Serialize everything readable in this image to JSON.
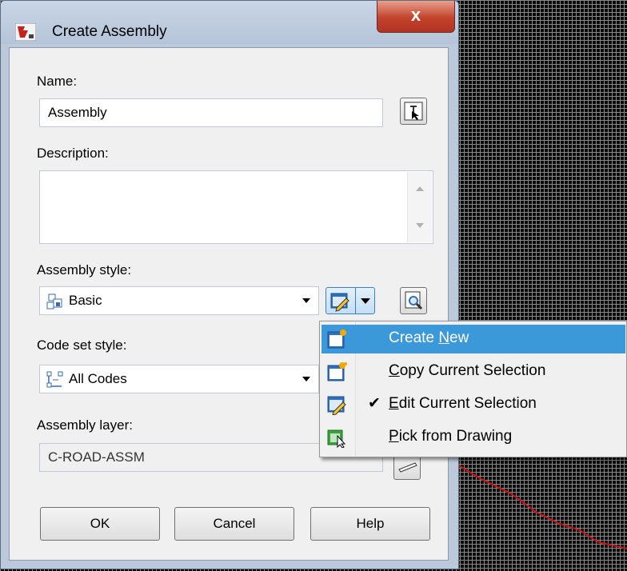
{
  "window": {
    "title": "Create Assembly",
    "close_label": "x"
  },
  "form": {
    "name_label": "Name:",
    "name_value": "Assembly",
    "description_label": "Description:",
    "description_value": "",
    "assembly_style_label": "Assembly style:",
    "assembly_style_value": "Basic",
    "code_set_style_label": "Code set style:",
    "code_set_style_value": "All Codes",
    "assembly_layer_label": "Assembly layer:",
    "assembly_layer_value": "C-ROAD-ASSM"
  },
  "buttons": {
    "ok": "OK",
    "cancel": "Cancel",
    "help": "Help"
  },
  "style_menu": {
    "items": [
      {
        "pre": "Create ",
        "accel": "N",
        "post": "ew",
        "checked": false,
        "highlighted": true,
        "icon": "create-new-icon"
      },
      {
        "pre": "",
        "accel": "C",
        "post": "opy Current Selection",
        "checked": false,
        "highlighted": false,
        "icon": "copy-selection-icon"
      },
      {
        "pre": "",
        "accel": "E",
        "post": "dit Current Selection",
        "checked": true,
        "highlighted": false,
        "icon": "edit-selection-icon"
      },
      {
        "pre": "",
        "accel": "P",
        "post": "ick from Drawing",
        "checked": false,
        "highlighted": false,
        "icon": "pick-from-drawing-icon"
      }
    ],
    "check_glyph": "✔"
  },
  "colors": {
    "menu_highlight": "#3b98d9",
    "close_button": "#c2432c",
    "drawing_line": "#d01010"
  }
}
